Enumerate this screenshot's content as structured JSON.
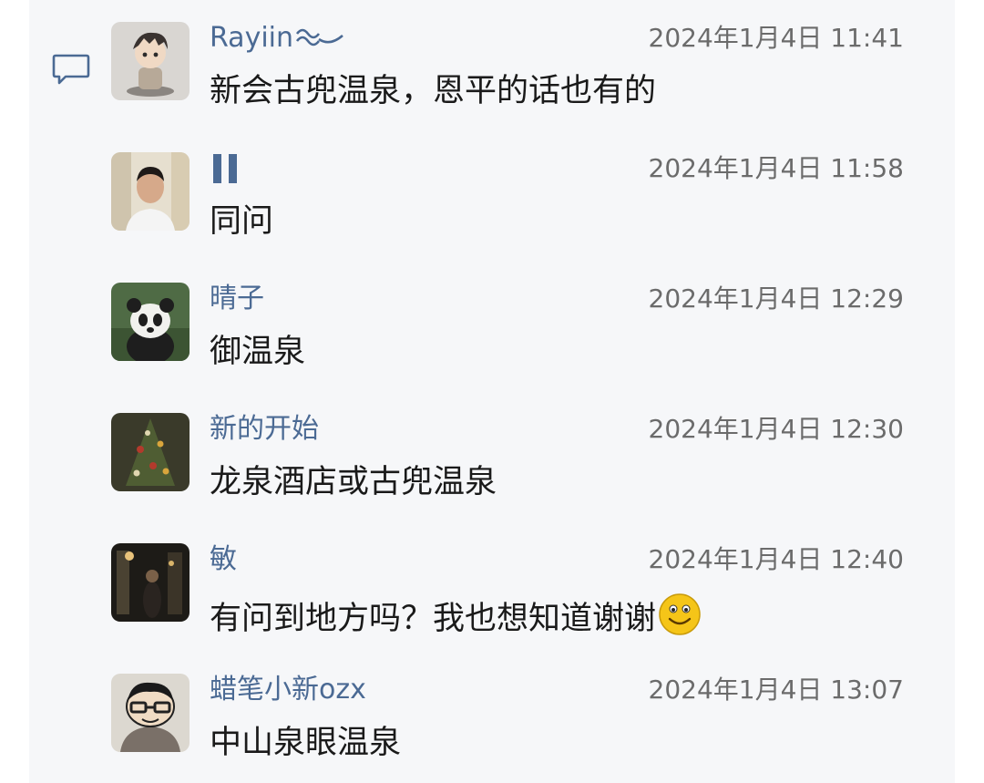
{
  "messages": [
    {
      "name": "Rayiin",
      "time": "2024年1月4日 11:41",
      "text": "新会古兜温泉，恩平的话也有的",
      "avatar": "figurine-avatar",
      "name_icon": "wave-icon"
    },
    {
      "name": "",
      "time": "2024年1月4日 11:58",
      "text": "同问",
      "avatar": "man-photo-avatar",
      "name_icon": "vertical-bars-icon"
    },
    {
      "name": "晴子",
      "time": "2024年1月4日 12:29",
      "text": "御温泉",
      "avatar": "panda-avatar"
    },
    {
      "name": "新的开始",
      "time": "2024年1月4日 12:30",
      "text": "龙泉酒店或古兜温泉",
      "avatar": "christmas-tree-avatar"
    },
    {
      "name": "敏",
      "time": "2024年1月4日 12:40",
      "text": "有问到地方吗？我也想知道谢谢",
      "emoji": "smiley-emoji",
      "avatar": "night-street-avatar"
    },
    {
      "name": "蜡笔小新ozx",
      "time": "2024年1月4日 13:07",
      "text": "中山泉眼温泉",
      "avatar": "cartoon-avatar"
    }
  ],
  "icons": {
    "comment": "comment-bubble-icon"
  },
  "colors": {
    "panel_bg": "#f6f7f9",
    "name": "#4b6a94",
    "time": "#6b6b6b",
    "text": "#1a1a1a"
  }
}
